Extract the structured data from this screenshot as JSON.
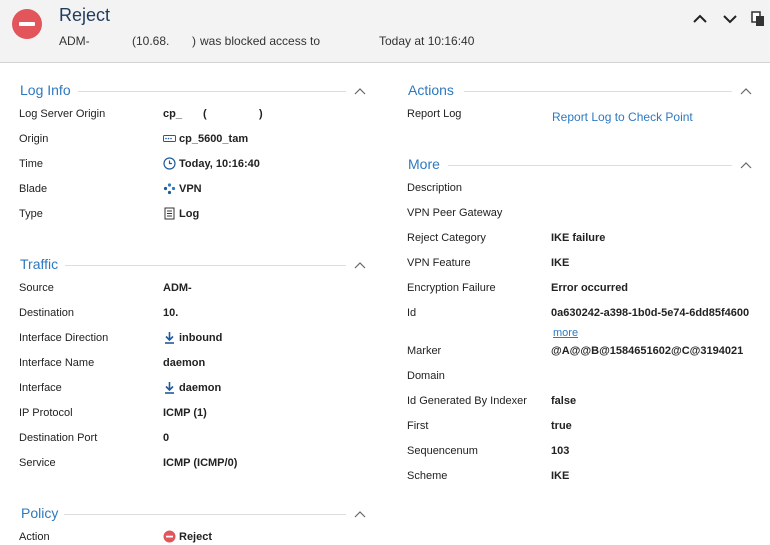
{
  "header": {
    "title": "Reject",
    "sub_source": "ADM-",
    "sub_ip": "(10.68.",
    "sub_ip_close": ")",
    "sub_blocked": "was blocked access to",
    "sub_time": "Today at  10:16:40"
  },
  "colors": {
    "accent": "#2e79c0",
    "reject": "#e2555b",
    "header_bg": "#f3f3f3",
    "title": "#1f3c5e"
  },
  "log_info": {
    "title": "Log Info",
    "rows": [
      {
        "label": "Log Server Origin",
        "value": "cp_",
        "value2": "(",
        "value3": ")"
      },
      {
        "label": "Origin",
        "value": "cp_5600_tam",
        "icon": "gateway-icon"
      },
      {
        "label": "Time",
        "value": "Today, 10:16:40",
        "icon": "clock-icon"
      },
      {
        "label": "Blade",
        "value": "VPN",
        "icon": "vpn-icon"
      },
      {
        "label": "Type",
        "value": "Log",
        "icon": "log-icon"
      }
    ]
  },
  "traffic": {
    "title": "Traffic",
    "rows": [
      {
        "label": "Source",
        "value": "ADM-"
      },
      {
        "label": "Destination",
        "value": "10."
      },
      {
        "label": "Interface Direction",
        "value": "inbound",
        "icon": "inbound-arrow-icon"
      },
      {
        "label": "Interface Name",
        "value": "daemon"
      },
      {
        "label": "Interface",
        "value": "daemon",
        "icon": "inbound-arrow-icon"
      },
      {
        "label": "IP Protocol",
        "value": "ICMP (1)"
      },
      {
        "label": "Destination Port",
        "value": "0"
      },
      {
        "label": "Service",
        "value": "ICMP (ICMP/0)"
      }
    ]
  },
  "policy": {
    "title": "Policy",
    "rows": [
      {
        "label": "Action",
        "value": "Reject",
        "icon": "reject-icon"
      }
    ]
  },
  "actions": {
    "title": "Actions",
    "rows": [
      {
        "label": "Report Log",
        "link": "Report Log to Check Point"
      }
    ]
  },
  "more": {
    "title": "More",
    "more_link": "more",
    "rows": [
      {
        "label": "Description",
        "value": ""
      },
      {
        "label": "VPN Peer Gateway",
        "value": ""
      },
      {
        "label": "Reject Category",
        "value": "IKE failure"
      },
      {
        "label": "VPN Feature",
        "value": "IKE"
      },
      {
        "label": "Encryption Failure",
        "value": "Error occurred"
      },
      {
        "label": "Id",
        "value": "0a630242-a398-1b0d-5e74-6dd85f4600"
      },
      {
        "label": "Marker",
        "value": "@A@@B@1584651602@C@3194021"
      },
      {
        "label": "Domain",
        "value": ""
      },
      {
        "label": "Id Generated By Indexer",
        "value": "false"
      },
      {
        "label": "First",
        "value": "true"
      },
      {
        "label": "Sequencenum",
        "value": "103"
      },
      {
        "label": "Scheme",
        "value": "IKE"
      }
    ]
  }
}
